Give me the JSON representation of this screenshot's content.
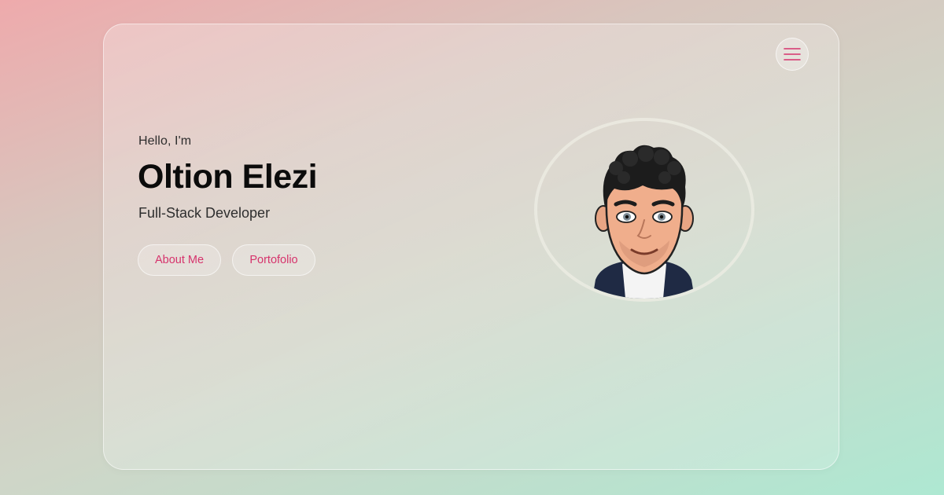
{
  "hero": {
    "greeting": "Hello, I'm",
    "name": "Oltion Elezi",
    "role": "Full-Stack Developer"
  },
  "buttons": {
    "about_label": "About Me",
    "portfolio_label": "Portofolio"
  },
  "menu": {
    "icon": "hamburger-menu-icon"
  },
  "avatar": {
    "icon": "cartoon-avatar"
  },
  "colors": {
    "accent": "#d6336c",
    "text_dark": "#0b0b0b",
    "background_start": "#eeaaac",
    "background_end": "#aee8d2"
  }
}
